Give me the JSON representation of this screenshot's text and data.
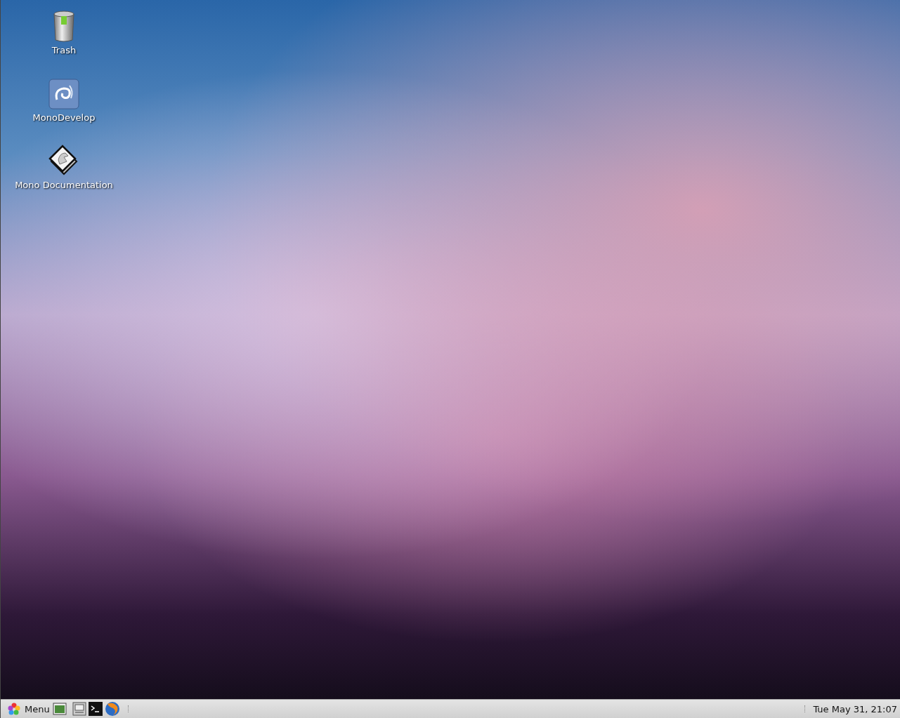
{
  "desktop_icons": [
    {
      "kind": "trash",
      "label": "Trash"
    },
    {
      "kind": "ide",
      "label": "MonoDevelop"
    },
    {
      "kind": "docs",
      "label": "Mono Documentation"
    }
  ],
  "panel": {
    "menu": {
      "label": "Menu"
    },
    "clock": "Tue May 31, 21:07"
  }
}
